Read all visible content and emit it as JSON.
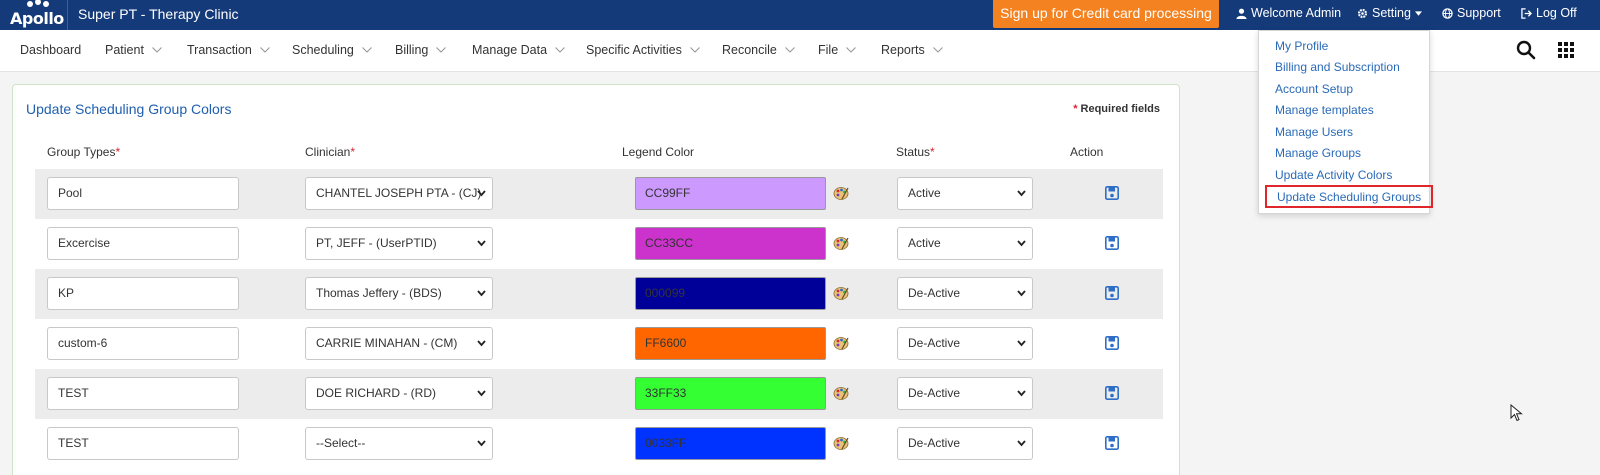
{
  "app": {
    "logo_text": "Apollo",
    "title": "Super PT - Therapy Clinic"
  },
  "topbar": {
    "signup_label": "Sign up for Credit card processing",
    "welcome_label": "Welcome Admin",
    "setting_label": "Setting",
    "support_label": "Support",
    "logoff_label": "Log Off"
  },
  "menu": {
    "items": [
      {
        "label": "Dashboard"
      },
      {
        "label": "Patient"
      },
      {
        "label": "Transaction"
      },
      {
        "label": "Scheduling"
      },
      {
        "label": "Billing"
      },
      {
        "label": "Manage Data"
      },
      {
        "label": "Specific Activities"
      },
      {
        "label": "Reconcile"
      },
      {
        "label": "File"
      },
      {
        "label": "Reports"
      }
    ]
  },
  "panel": {
    "title": "Update Scheduling Group Colors",
    "required_note": "Required fields",
    "required_star": "*",
    "columns": {
      "group_types": "Group Types",
      "clinician": "Clinician",
      "legend_color": "Legend Color",
      "status": "Status",
      "action": "Action"
    }
  },
  "rows": [
    {
      "group": "Pool",
      "clinician": "CHANTEL JOSEPH PTA - (CJ)",
      "color": "CC99FF",
      "hex": "#CC99FF",
      "status": "Active"
    },
    {
      "group": "Excercise",
      "clinician": "PT, JEFF - (UserPTID)",
      "color": "CC33CC",
      "hex": "#CC33CC",
      "status": "Active"
    },
    {
      "group": "KP",
      "clinician": "Thomas Jeffery - (BDS)",
      "color": "000099",
      "hex": "#000099",
      "status": "De-Active"
    },
    {
      "group": "custom-6",
      "clinician": "CARRIE MINAHAN - (CM)",
      "color": "FF6600",
      "hex": "#FF6600",
      "status": "De-Active"
    },
    {
      "group": "TEST",
      "clinician": "DOE RICHARD - (RD)",
      "color": "33FF33",
      "hex": "#33FF33",
      "status": "De-Active"
    },
    {
      "group": "TEST",
      "clinician": "--Select--",
      "color": "0033FF",
      "hex": "#0033FF",
      "status": "De-Active"
    }
  ],
  "setting_menu": {
    "items": [
      {
        "label": "My Profile"
      },
      {
        "label": "Billing and Subscription"
      },
      {
        "label": "Account Setup"
      },
      {
        "label": "Manage templates"
      },
      {
        "label": "Manage Users"
      },
      {
        "label": "Manage Groups"
      },
      {
        "label": "Update Activity Colors"
      },
      {
        "label": "Update Scheduling Groups"
      }
    ]
  },
  "colors": {
    "topbar": "#143a7a",
    "signup": "#f58220",
    "link": "#2a6ab8",
    "required": "#d9232d",
    "highlight_border": "#e0262b"
  }
}
